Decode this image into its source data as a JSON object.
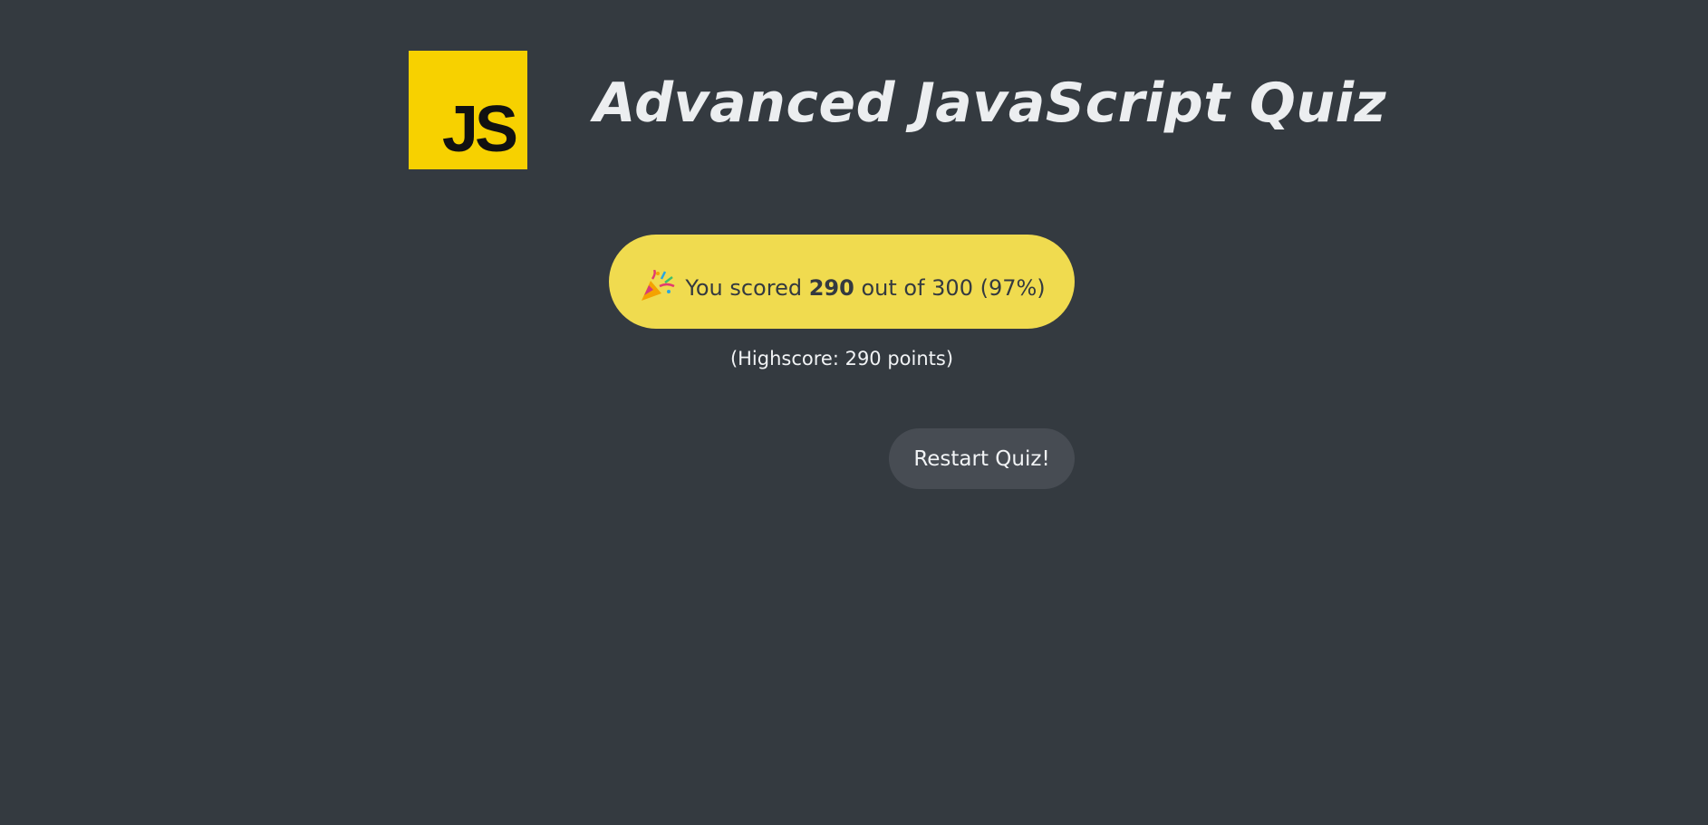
{
  "header": {
    "logo_text": "JS",
    "title": "Advanced JavaScript Quiz"
  },
  "result": {
    "icon": "party-popper-icon",
    "prefix": "You scored",
    "points": "290",
    "suffix": "out of 300 (97%)",
    "highscore": "(Highscore: 290 points)"
  },
  "actions": {
    "restart_label": "Restart Quiz!"
  },
  "colors": {
    "background": "#343a40",
    "accent": "#f0db4f",
    "logo": "#f7d100",
    "button": "#474c53"
  }
}
